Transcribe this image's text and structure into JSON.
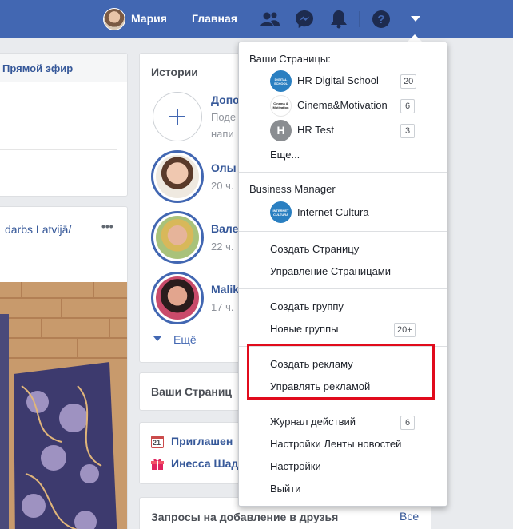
{
  "topbar": {
    "user_name": "Мария",
    "home_label": "Главная",
    "icons": [
      "friends-icon",
      "messenger-icon",
      "notifications-icon",
      "help-icon",
      "menu-caret-icon"
    ],
    "bg_color": "#4267b2"
  },
  "left_feed": {
    "live_label": "Прямой эфир",
    "post_title": "darbs Latvijā/",
    "more_label": "•••"
  },
  "stories": {
    "title": "Истории",
    "add_title": "Допо",
    "add_sub1": "Поде",
    "add_sub2": "напи",
    "items": [
      {
        "name": "Олы",
        "time": "20 ч."
      },
      {
        "name": "Вале",
        "time": "22 ч."
      },
      {
        "name": "Malik",
        "time": "17 ч."
      }
    ],
    "more_label": "Ещё"
  },
  "pages_card": {
    "title": "Ваши Страниц"
  },
  "events_card": {
    "row1_day": "21",
    "row1_label": "Приглашен",
    "row2_label": "Инесса Шад"
  },
  "friends_card": {
    "title": "Запросы на добавление в друзья",
    "all_label": "Все"
  },
  "dropdown": {
    "pages_header": "Ваши Страницы:",
    "pages": [
      {
        "label": "HR Digital School",
        "badge": "20",
        "icon_text": "DIGITAL SCHOOL",
        "color": "#2a7fc1"
      },
      {
        "label": "Cinema&Motivation",
        "badge": "6",
        "icon_text": "Cinema & Motivation",
        "color": "#ffffff"
      },
      {
        "label": "HR Test",
        "badge": "3",
        "icon_text": "H",
        "color": "#8a8d91"
      }
    ],
    "more_label": "Еще...",
    "bm_header": "Business Manager",
    "bm_item": {
      "label": "Internet Cultura",
      "icon_text": "INTERNET CULTURA",
      "color": "#2a7fc1"
    },
    "create_page": "Создать Страницу",
    "manage_pages": "Управление Страницами",
    "create_group": "Создать группу",
    "new_groups": "Новые группы",
    "new_groups_badge": "20+",
    "create_ad": "Создать рекламу",
    "manage_ads": "Управлять рекламой",
    "activity_log": "Журнал действий",
    "activity_badge": "6",
    "feed_settings": "Настройки Ленты новостей",
    "settings": "Настройки",
    "logout": "Выйти",
    "highlight_color": "#e10b1c"
  }
}
